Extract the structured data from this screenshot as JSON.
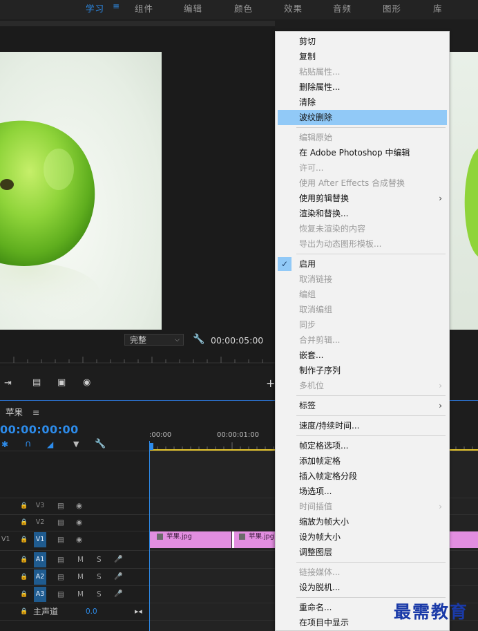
{
  "workspace_tabs": [
    {
      "label": "学习",
      "active": true
    },
    {
      "label": "组件",
      "active": false
    },
    {
      "label": "编辑",
      "active": false
    },
    {
      "label": "颜色",
      "active": false
    },
    {
      "label": "效果",
      "active": false
    },
    {
      "label": "音频",
      "active": false
    },
    {
      "label": "图形",
      "active": false
    },
    {
      "label": "库",
      "active": false
    }
  ],
  "monitor": {
    "quality": "完整",
    "timecode": "00:00:05:00"
  },
  "timeline": {
    "title": "苹果",
    "timecode": "00:00:00:00",
    "ruler_labels": [
      ":00:00",
      "00:00:01:00"
    ],
    "tracks": [
      {
        "name": "V3",
        "kind": "video",
        "targeted": false
      },
      {
        "name": "V2",
        "kind": "video",
        "targeted": false
      },
      {
        "name": "V1",
        "kind": "video",
        "targeted": true,
        "src": "V1"
      },
      {
        "name": "A1",
        "kind": "audio",
        "targeted": true,
        "m": "M",
        "s": "S"
      },
      {
        "name": "A2",
        "kind": "audio",
        "targeted": true,
        "m": "M",
        "s": "S"
      },
      {
        "name": "A3",
        "kind": "audio",
        "targeted": true,
        "m": "M",
        "s": "S"
      }
    ],
    "master": {
      "label": "主声道",
      "value": "0.0"
    },
    "clips": [
      {
        "name": "苹果.jpg"
      },
      {
        "name": "苹果.jpg"
      }
    ]
  },
  "context_menu": [
    {
      "label": "剪切",
      "enabled": true
    },
    {
      "label": "复制",
      "enabled": true
    },
    {
      "label": "粘贴属性...",
      "enabled": false
    },
    {
      "label": "删除属性...",
      "enabled": true
    },
    {
      "label": "清除",
      "enabled": true
    },
    {
      "label": "波纹删除",
      "enabled": true,
      "highlighted": true
    },
    {
      "separator": true
    },
    {
      "label": "编辑原始",
      "enabled": false
    },
    {
      "label": "在 Adobe Photoshop 中编辑",
      "enabled": true
    },
    {
      "label": "许可...",
      "enabled": false
    },
    {
      "label": "使用 After Effects 合成替换",
      "enabled": false
    },
    {
      "label": "使用剪辑替换",
      "enabled": true,
      "submenu": true
    },
    {
      "label": "渲染和替换...",
      "enabled": true
    },
    {
      "label": "恢复未渲染的内容",
      "enabled": false
    },
    {
      "label": "导出为动态图形模板...",
      "enabled": false
    },
    {
      "separator": true
    },
    {
      "label": "启用",
      "enabled": true,
      "checked": true
    },
    {
      "label": "取消链接",
      "enabled": false
    },
    {
      "label": "编组",
      "enabled": false
    },
    {
      "label": "取消编组",
      "enabled": false
    },
    {
      "label": "同步",
      "enabled": false
    },
    {
      "label": "合并剪辑...",
      "enabled": false
    },
    {
      "label": "嵌套...",
      "enabled": true
    },
    {
      "label": "制作子序列",
      "enabled": true
    },
    {
      "label": "多机位",
      "enabled": false,
      "submenu": true
    },
    {
      "separator": true
    },
    {
      "label": "标签",
      "enabled": true,
      "submenu": true
    },
    {
      "separator": true
    },
    {
      "label": "速度/持续时间...",
      "enabled": true
    },
    {
      "separator": true
    },
    {
      "label": "帧定格选项...",
      "enabled": true
    },
    {
      "label": "添加帧定格",
      "enabled": true
    },
    {
      "label": "插入帧定格分段",
      "enabled": true
    },
    {
      "label": "场选项...",
      "enabled": true
    },
    {
      "label": "时间插值",
      "enabled": false,
      "submenu": true
    },
    {
      "label": "缩放为帧大小",
      "enabled": true
    },
    {
      "label": "设为帧大小",
      "enabled": true
    },
    {
      "label": "调整图层",
      "enabled": true
    },
    {
      "separator": true
    },
    {
      "label": "链接媒体...",
      "enabled": false
    },
    {
      "label": "设为脱机...",
      "enabled": true
    },
    {
      "separator": true
    },
    {
      "label": "重命名...",
      "enabled": true
    },
    {
      "label": "在项目中显示",
      "enabled": true
    }
  ],
  "watermark": "最需教育",
  "colors": {
    "accent": "#2d8ceb",
    "clip": "#e28ee0",
    "menu_highlight": "#91c9f7"
  }
}
